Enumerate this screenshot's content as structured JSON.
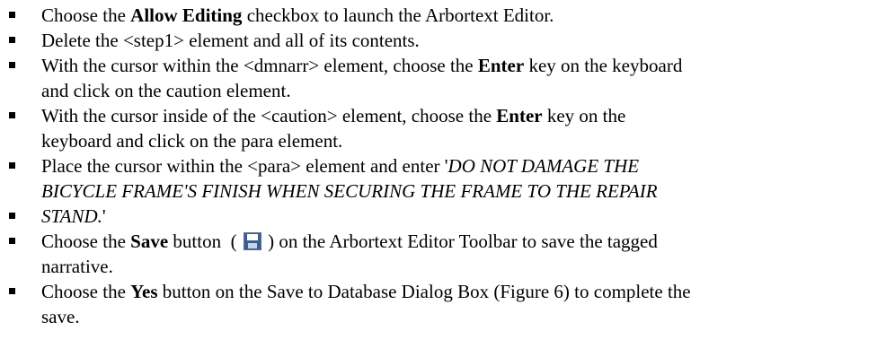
{
  "items": [
    {
      "line1_a": "Choose the ",
      "line1_b": "Allow Editing",
      "line1_c": " checkbox to launch the Arbortext Editor."
    },
    {
      "line1_a": "Delete the <step1> element and all of its contents."
    },
    {
      "line1_a": "With the cursor within the <dmnarr> element, choose the ",
      "line1_b": "Enter",
      "line1_c": " key on the keyboard",
      "line2_a": "and click on the caution element."
    },
    {
      "line1_a": "With the cursor inside of the <caution> element, choose the ",
      "line1_b": "Enter",
      "line1_c": " key on the",
      "line2_a": "keyboard and click on the para element."
    },
    {
      "line1_a": "Place the cursor within the <para> element and enter '",
      "line1_b": "DO NOT DAMAGE THE",
      "line2_a": "BICYCLE FRAME'S FINISH WHEN SECURING THE FRAME TO THE REPAIR"
    },
    {
      "line1_a": "STAND.",
      "line1_b": "'"
    },
    {
      "line1_a": "Choose the ",
      "line1_b": "Save",
      "line1_c": " button  ( ",
      "line1_d": " ) on the Arbortext Editor Toolbar to save the tagged",
      "line2_a": "narrative."
    },
    {
      "line1_a": "Choose the ",
      "line1_b": "Yes",
      "line1_c": " button on the Save to Database Dialog Box (Figure 6) to complete the",
      "line2_a": "save."
    }
  ],
  "icons": {
    "save": "floppy-disk-icon"
  }
}
